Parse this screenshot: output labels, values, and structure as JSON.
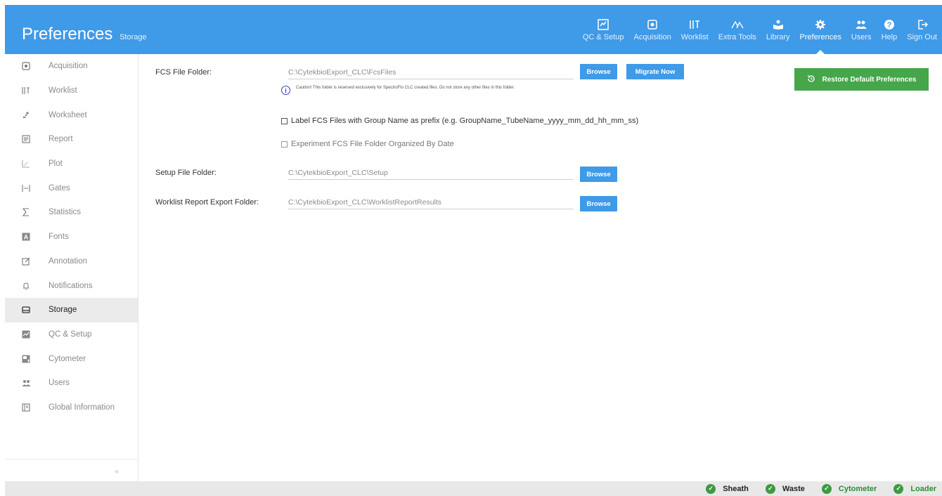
{
  "header": {
    "title": "Preferences",
    "subtitle": "Storage"
  },
  "nav": {
    "tabs": [
      {
        "label": "QC & Setup",
        "icon": "qc-setup-icon"
      },
      {
        "label": "Acquisition",
        "icon": "acquisition-icon"
      },
      {
        "label": "Worklist",
        "icon": "worklist-icon"
      },
      {
        "label": "Extra Tools",
        "icon": "extra-tools-icon"
      },
      {
        "label": "Library",
        "icon": "library-icon"
      },
      {
        "label": "Preferences",
        "icon": "gear-icon"
      },
      {
        "label": "Users",
        "icon": "users-icon"
      },
      {
        "label": "Help",
        "icon": "help-icon"
      },
      {
        "label": "Sign Out",
        "icon": "sign-out-icon"
      }
    ],
    "active": "Preferences"
  },
  "sidebar": {
    "items": [
      {
        "label": "Acquisition",
        "icon": "acquisition-icon"
      },
      {
        "label": "Worklist",
        "icon": "worklist-icon"
      },
      {
        "label": "Worksheet",
        "icon": "worksheet-icon"
      },
      {
        "label": "Report",
        "icon": "report-icon"
      },
      {
        "label": "Plot",
        "icon": "plot-icon"
      },
      {
        "label": "Gates",
        "icon": "gates-icon"
      },
      {
        "label": "Statistics",
        "icon": "sigma-icon"
      },
      {
        "label": "Fonts",
        "icon": "font-icon"
      },
      {
        "label": "Annotation",
        "icon": "edit-icon"
      },
      {
        "label": "Notifications",
        "icon": "bell-icon"
      },
      {
        "label": "Storage",
        "icon": "drive-icon"
      },
      {
        "label": "QC & Setup",
        "icon": "qc-setup-icon"
      },
      {
        "label": "Cytometer",
        "icon": "cytometer-icon"
      },
      {
        "label": "Users",
        "icon": "users-icon"
      },
      {
        "label": "Global Information",
        "icon": "info-doc-icon"
      }
    ],
    "active": "Storage",
    "collapse_label": "«"
  },
  "storage": {
    "fcs_label": "FCS File Folder:",
    "fcs_path": "C:\\CytekbioExport_CLC\\FcsFiles",
    "browse_label": "Browse",
    "migrate_label": "Migrate Now",
    "caution_text": "Caution! This folder is reserved exclusively for SpectroFlo CLC created files. Do not store any other files in this folder.",
    "label_prefix_text": "Label FCS Files with Group Name as prefix (e.g. GroupName_TubeName_yyyy_mm_dd_hh_mm_ss)",
    "organize_by_date_text": "Experiment FCS File Folder Organized By Date",
    "setup_label": "Setup File Folder:",
    "setup_path": "C:\\CytekbioExport_CLC\\Setup",
    "worklist_label": "Worklist Report Export Folder:",
    "worklist_path": "C:\\CytekbioExport_CLC\\WorklistReportResults",
    "restore_label": "Restore Default Preferences"
  },
  "status": {
    "items": [
      "Sheath",
      "Waste",
      "Cytometer",
      "Loader"
    ]
  },
  "colors": {
    "header_blue": "#3f9ae8",
    "restore_green": "#45a64a",
    "status_green": "#3c9b3e"
  }
}
